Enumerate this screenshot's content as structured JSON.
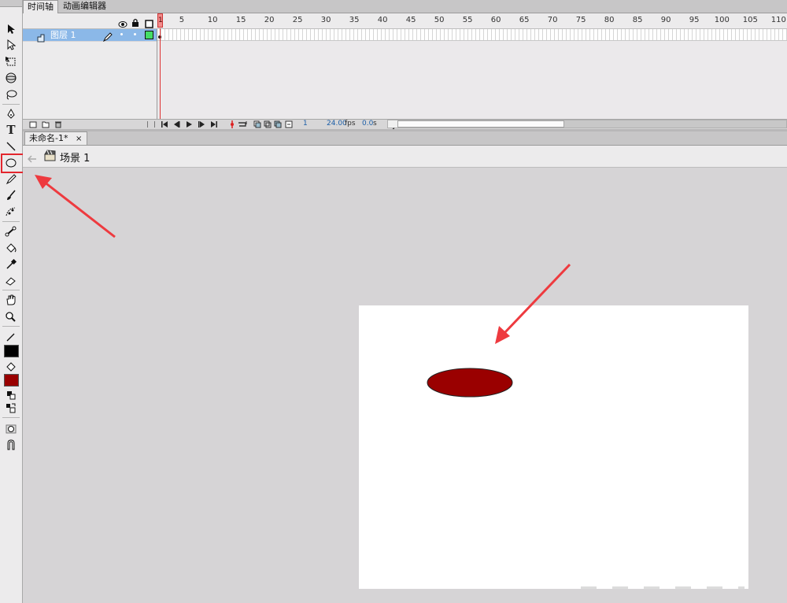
{
  "timeline": {
    "tab_timeline": "时间轴",
    "tab_motion_editor": "动画编辑器",
    "layer_name": "图层 1",
    "playhead_frame": "1",
    "ruler_ticks": [
      "5",
      "10",
      "15",
      "20",
      "25",
      "30",
      "35",
      "40",
      "45",
      "50",
      "55",
      "60",
      "65",
      "70",
      "75",
      "80",
      "85",
      "90",
      "95",
      "100",
      "105",
      "110"
    ],
    "current_frame": "1",
    "fps": "24.00",
    "fps_unit": "fps",
    "time": "0.0",
    "time_unit": "s"
  },
  "document": {
    "tab_title": "未命名-1*",
    "tab_close": "×",
    "scene_name": "场景 1"
  },
  "colors": {
    "stroke": "#000000",
    "fill": "#990000",
    "oval_fill": "#9a0000",
    "highlight": "#e3262e"
  },
  "icons": [
    "selection-icon",
    "subselection-icon",
    "free-transform-icon",
    "3d-rotation-icon",
    "lasso-icon",
    "pen-icon",
    "text-icon",
    "line-icon",
    "oval-icon",
    "pencil-icon",
    "brush-icon",
    "deco-icon",
    "bone-icon",
    "paint-bucket-icon",
    "eyedropper-icon",
    "eraser-icon",
    "hand-icon",
    "zoom-icon",
    "stroke-color-icon",
    "fill-color-icon",
    "swap-colors-icon",
    "object-drawing-icon",
    "snap-icon"
  ]
}
